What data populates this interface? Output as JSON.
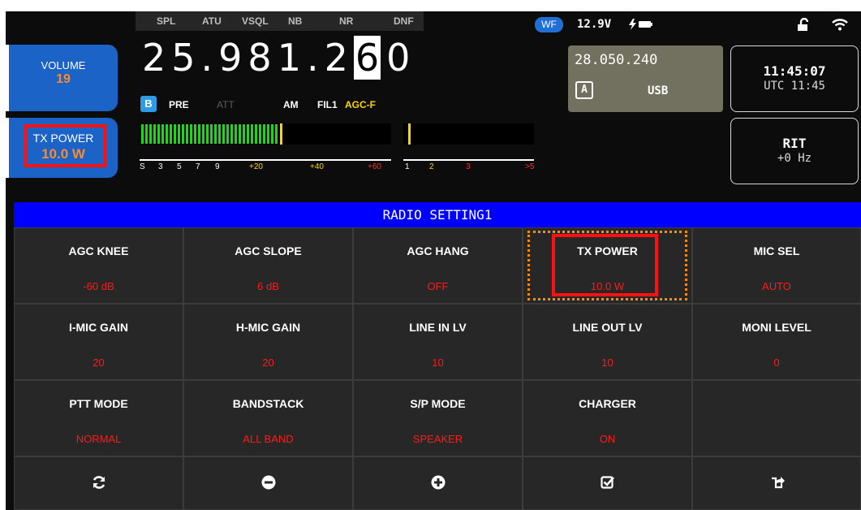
{
  "status": {
    "flags": [
      "SPL",
      "ATU",
      "VSQL",
      "NB",
      "NR",
      "DNF"
    ],
    "wf_label": "WF",
    "voltage": "12.9V"
  },
  "left": {
    "volume_label": "VOLUME",
    "volume_value": "19",
    "txpower_label": "TX POWER",
    "txpower_value": "10.0 W"
  },
  "vfo_a": {
    "freq_prefix": "25.981.2",
    "freq_cursor": "6",
    "freq_suffix": "0",
    "vfo_badge": "B",
    "pre": "PRE",
    "att": "ATT",
    "mode": "AM",
    "filter": "FIL1",
    "agc": "AGC-F"
  },
  "vfo_b": {
    "freq": "28.050.240",
    "badge": "A",
    "mode": "USB"
  },
  "clock": {
    "time": "11:45:07",
    "utc": "UTC 11:45"
  },
  "rit": {
    "label": "RIT",
    "value": "+0 Hz"
  },
  "s_meter": {
    "scale": [
      "S",
      "3",
      "5",
      "7",
      "9",
      "+20",
      "+40",
      "+60"
    ],
    "level": 0.56
  },
  "swr_meter": {
    "scale": [
      "1",
      "2",
      "3",
      ">5"
    ],
    "level": 0.02
  },
  "menu": {
    "title": "RADIO SETTING1",
    "items": [
      {
        "name": "AGC KNEE",
        "value": "-60 dB"
      },
      {
        "name": "AGC SLOPE",
        "value": "6 dB"
      },
      {
        "name": "AGC HANG",
        "value": "OFF"
      },
      {
        "name": "TX POWER",
        "value": "10.0 W"
      },
      {
        "name": "MIC SEL",
        "value": "AUTO"
      },
      {
        "name": "I-MIC GAIN",
        "value": "20"
      },
      {
        "name": "H-MIC GAIN",
        "value": "20"
      },
      {
        "name": "LINE IN LV",
        "value": "10"
      },
      {
        "name": "LINE OUT LV",
        "value": "10"
      },
      {
        "name": "MONI LEVEL",
        "value": "0"
      },
      {
        "name": "PTT MODE",
        "value": "NORMAL"
      },
      {
        "name": "BANDSTACK",
        "value": "ALL BAND"
      },
      {
        "name": "S/P MODE",
        "value": "SPEAKER"
      },
      {
        "name": "CHARGER",
        "value": "ON"
      },
      {
        "name": "",
        "value": ""
      }
    ],
    "actions": [
      "refresh-icon",
      "minus-circle-icon",
      "plus-circle-icon",
      "check-square-icon",
      "share-icon"
    ]
  },
  "colors": {
    "accent_blue": "#1b63c6",
    "title_bar": "#0000ff",
    "value_red": "#ff1a1a",
    "meter_green": "#22d322",
    "meter_yellow": "#ffd400",
    "highlight_orange": "#ff8c00"
  }
}
